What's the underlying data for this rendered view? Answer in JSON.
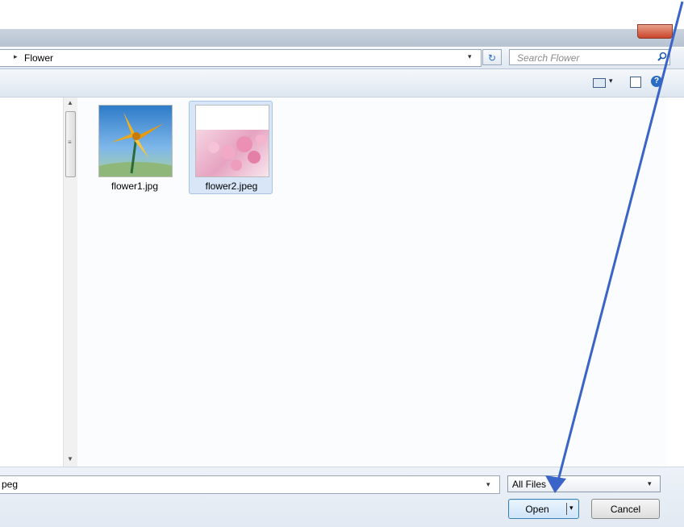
{
  "address_bar": {
    "breadcrumb_arrow": "▸",
    "current_folder": "Flower",
    "dropdown_glyph": "▾",
    "refresh_glyph": "↻",
    "search_placeholder": "Search Flower",
    "search_icon": "search-icon"
  },
  "toolbar": {
    "views_icon": "views-icon",
    "views_dropdown_glyph": "▾",
    "preview_pane_icon": "preview-pane-icon",
    "help_glyph": "?"
  },
  "navigation": {
    "scroll_up_glyph": "▲",
    "scroll_down_glyph": "▼",
    "scroll_grip_glyph": "≡"
  },
  "files": [
    {
      "name": "flower1.jpg",
      "selected": false
    },
    {
      "name": "flower2.jpeg",
      "selected": true
    }
  ],
  "footer": {
    "filename_value": "peg",
    "filename_dropdown_glyph": "▾",
    "filetype_value": "All Files",
    "filetype_dropdown_glyph": "▾",
    "open_label": "Open",
    "open_dropdown_glyph": "▾",
    "cancel_label": "Cancel"
  },
  "colors": {
    "accent": "#2a6cc4",
    "selection": "#d8e6f8",
    "annotation_arrow": "#3b64c8"
  }
}
